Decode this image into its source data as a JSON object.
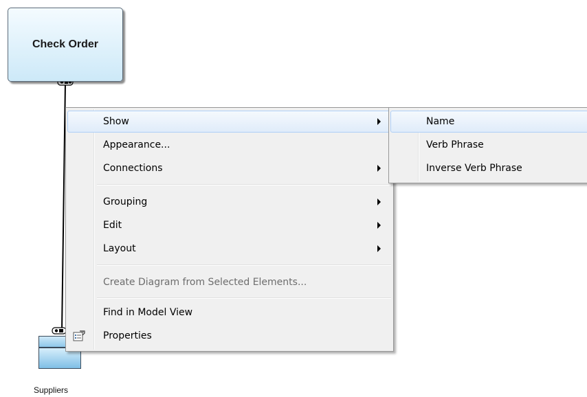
{
  "diagram": {
    "process_label": "Check Order",
    "entity_label": "Suppliers"
  },
  "context_menu": {
    "items": [
      {
        "label": "Show",
        "submenu": true
      },
      {
        "label": "Appearance...",
        "submenu": false
      },
      {
        "label": "Connections",
        "submenu": true
      },
      {
        "label": "Grouping",
        "submenu": true
      },
      {
        "label": "Edit",
        "submenu": true
      },
      {
        "label": "Layout",
        "submenu": true
      },
      {
        "label": "Create Diagram from Selected Elements...",
        "submenu": false,
        "disabled": true
      },
      {
        "label": "Find in Model View",
        "submenu": false
      },
      {
        "label": "Properties",
        "submenu": false,
        "icon": "properties-icon"
      }
    ],
    "highlighted": "Show"
  },
  "show_submenu": {
    "items": [
      {
        "label": "Name"
      },
      {
        "label": "Verb Phrase"
      },
      {
        "label": "Inverse Verb Phrase"
      }
    ],
    "highlighted": "Name"
  },
  "colors": {
    "process_fill": "#cde9f8",
    "entity_fill": "#8ec7ea",
    "menu_background": "#f0f0f0",
    "menu_highlight": "#e0ecfa"
  }
}
